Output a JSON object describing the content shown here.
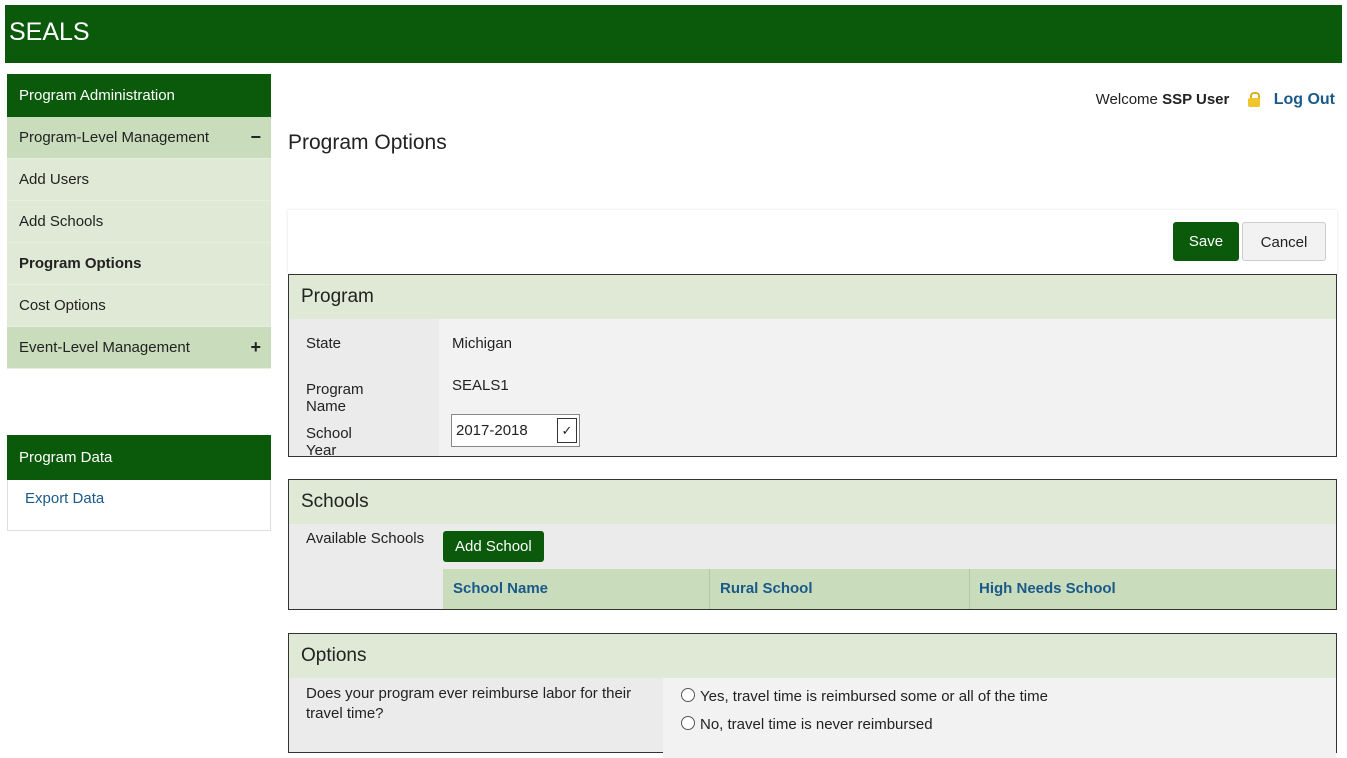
{
  "app": {
    "title": "SEALS"
  },
  "sidebar": {
    "header": "Program Administration",
    "items": [
      {
        "label": "Program-Level Management",
        "toggle": "−"
      },
      {
        "label": "Add Users"
      },
      {
        "label": "Add Schools"
      },
      {
        "label": "Program Options"
      },
      {
        "label": "Cost Options"
      },
      {
        "label": "Event-Level Management",
        "toggle": "+"
      }
    ],
    "data_header": "Program Data",
    "data_link": "Export Data"
  },
  "header": {
    "welcome": "Welcome",
    "user": "SSP User",
    "logout": "Log Out"
  },
  "page": {
    "title": "Program Options"
  },
  "toolbar": {
    "save": "Save",
    "cancel": "Cancel"
  },
  "program": {
    "heading": "Program",
    "state_label": "State",
    "state_value": "Michigan",
    "name_label": "Program Name",
    "name_value": "SEALS1",
    "year_label": "School Year",
    "year_value": "2017-2018"
  },
  "schools": {
    "heading": "Schools",
    "available_label": "Available Schools",
    "add_button": "Add School",
    "columns": [
      "School Name",
      "Rural School",
      "High Needs School"
    ]
  },
  "options": {
    "heading": "Options",
    "question": "Does your program ever reimburse labor for their travel time?",
    "choices": [
      "Yes, travel time is reimbursed some or all of the time",
      "No, travel time is never reimbursed"
    ]
  },
  "colors": {
    "brand": "#0b5a0b",
    "accent_light": "#dfe9d5",
    "link": "#1a5a8a"
  },
  "icons": {
    "lock": "lock-icon",
    "dropdown": "chevron-down-icon",
    "radio": "radio-button"
  }
}
